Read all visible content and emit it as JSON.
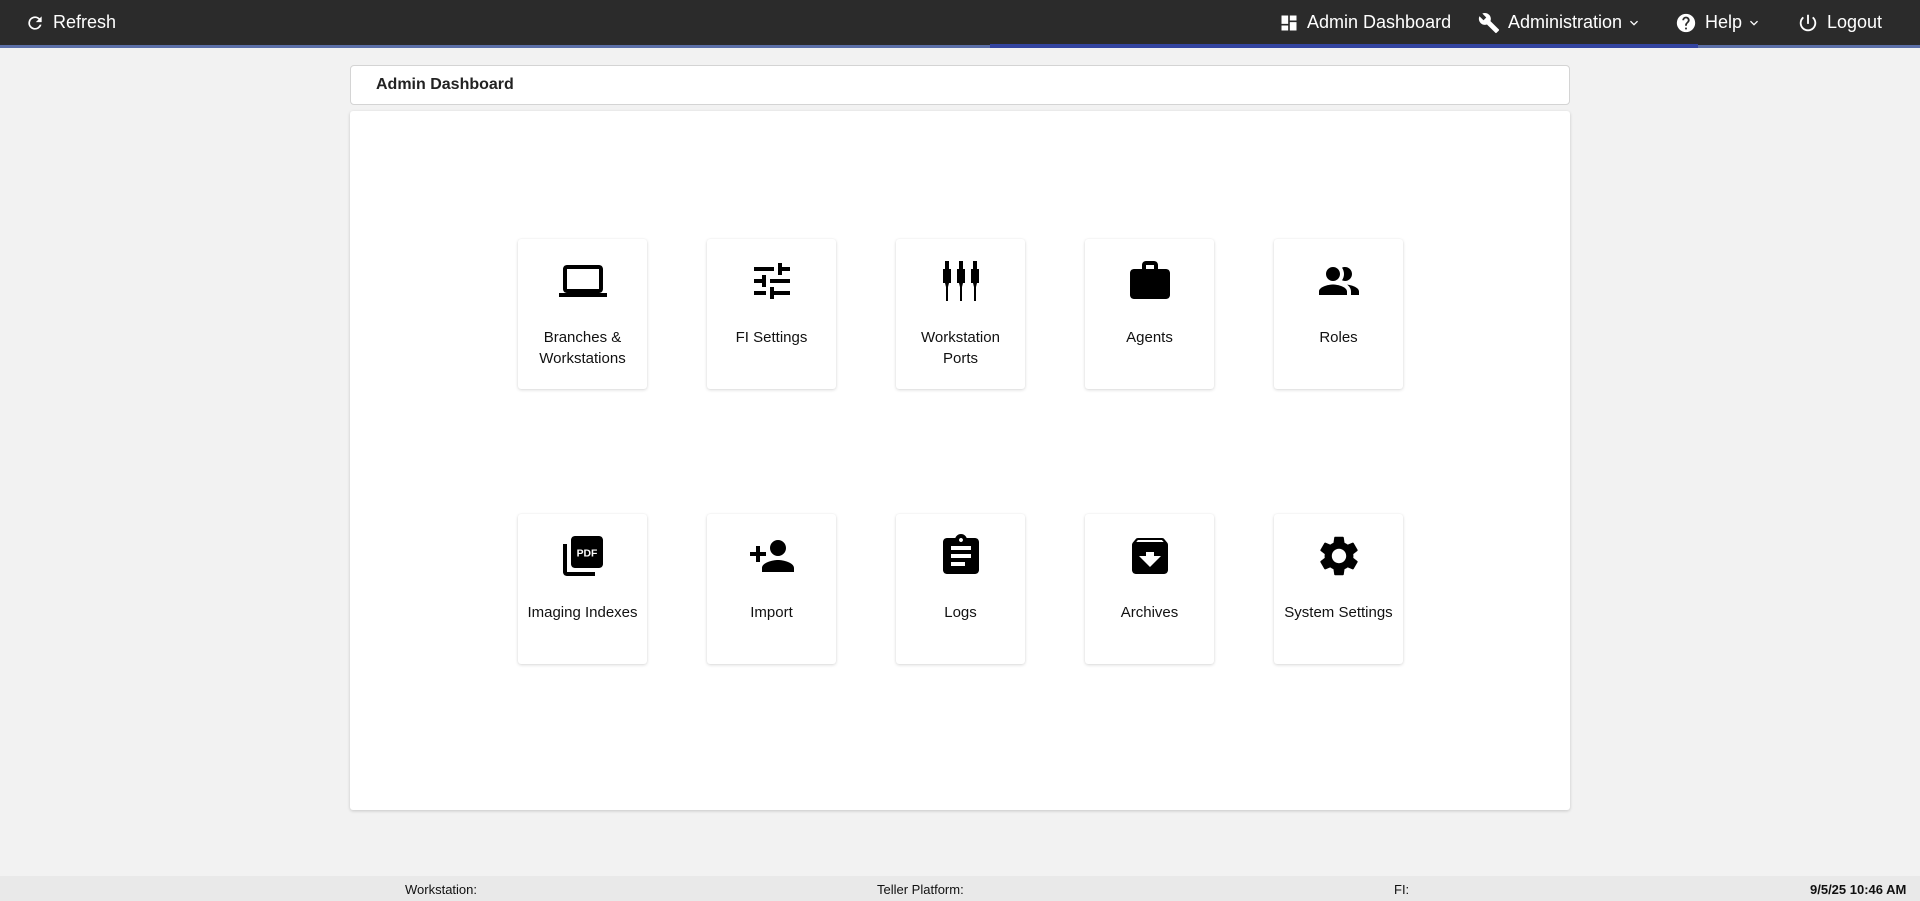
{
  "topbar": {
    "refresh_label": "Refresh",
    "admin_dashboard_label": "Admin Dashboard",
    "administration_label": "Administration",
    "help_label": "Help",
    "logout_label": "Logout"
  },
  "page": {
    "title": "Admin Dashboard"
  },
  "tiles": [
    {
      "label": "Branches & Workstations",
      "icon": "laptop-icon"
    },
    {
      "label": "FI Settings",
      "icon": "tune-icon"
    },
    {
      "label": "Workstation Ports",
      "icon": "ports-icon"
    },
    {
      "label": "Agents",
      "icon": "briefcase-icon"
    },
    {
      "label": "Roles",
      "icon": "people-icon"
    },
    {
      "label": "Imaging Indexes",
      "icon": "pdf-icon"
    },
    {
      "label": "Import",
      "icon": "person-add-icon"
    },
    {
      "label": "Logs",
      "icon": "clipboard-icon"
    },
    {
      "label": "Archives",
      "icon": "archive-icon"
    },
    {
      "label": "System Settings",
      "icon": "gear-icon"
    }
  ],
  "footer": {
    "workstation_label": "Workstation:",
    "teller_platform_label": "Teller Platform:",
    "fi_label": "FI:",
    "datetime": "9/5/25 10:46 AM"
  },
  "colors": {
    "topbar_bg": "#2b2b2b",
    "accent": "#3344a0",
    "page_bg": "#f2f2f2"
  }
}
